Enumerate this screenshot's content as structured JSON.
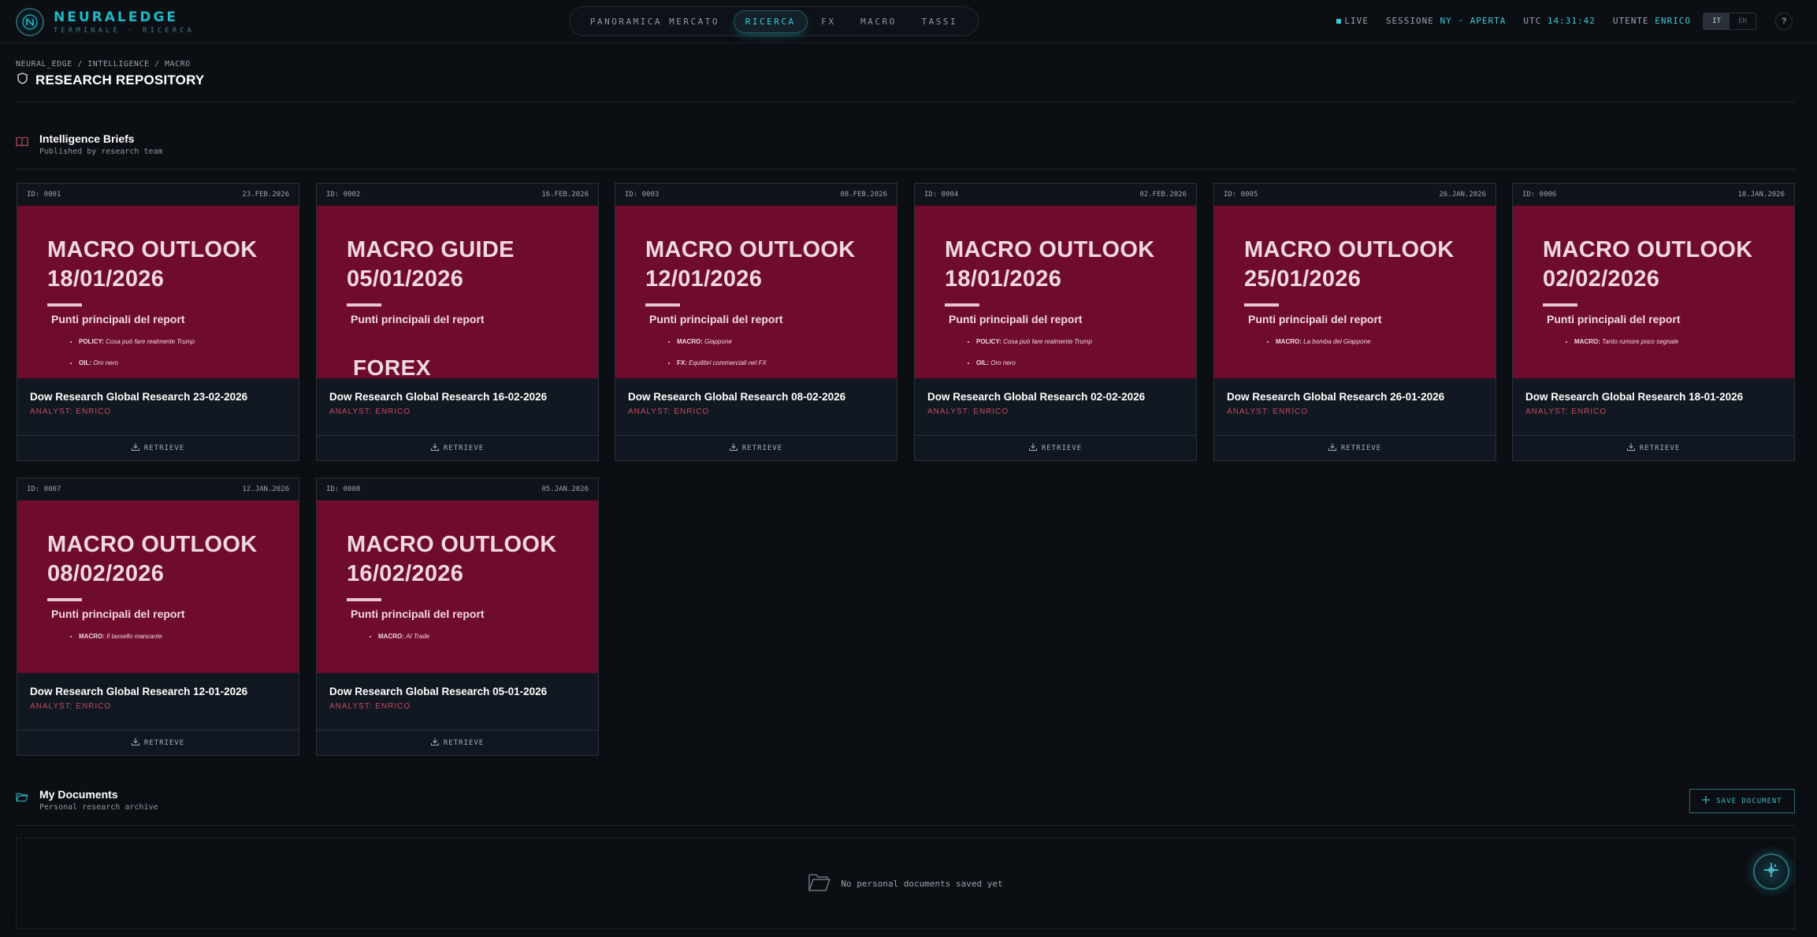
{
  "app": {
    "name": "NEURALEDGE",
    "subtitle": "TERMINALE · RICERCA"
  },
  "nav": {
    "tabs": [
      {
        "label": "PANORAMICA MERCATO",
        "active": false
      },
      {
        "label": "RICERCA",
        "active": true
      },
      {
        "label": "FX",
        "active": false
      },
      {
        "label": "MACRO",
        "active": false
      },
      {
        "label": "TASSI",
        "active": false
      }
    ]
  },
  "status": {
    "live": "LIVE",
    "session_label": "SESSIONE",
    "session_value": "NY · APERTA",
    "utc_label": "UTC",
    "utc_value": "14:31:42",
    "user_label": "UTENTE",
    "user_value": "ENRICO"
  },
  "lang": {
    "it": "IT",
    "en": "EN",
    "active": "IT"
  },
  "help": "?",
  "breadcrumb": "NEURAL_EDGE / INTELLIGENCE / MACRO",
  "page_title": "RESEARCH REPOSITORY",
  "briefs": {
    "title": "Intelligence Briefs",
    "subtitle": "Published by research team",
    "retrieve_label": "RETRIEVE",
    "cover_subtitle": "Punti principali del report",
    "cards": [
      {
        "id": "ID: 0001",
        "date": "23.FEB.2026",
        "cover_title": "MACRO OUTLOOK\n18/01/2026",
        "bullets": [
          {
            "k": "POLICY:",
            "v": "Cosa può fare realmente Trump"
          },
          {
            "k": "OIL:",
            "v": "Oro nero"
          }
        ],
        "name": "Dow Research Global Research 23-02-2026",
        "analyst": "ANALYST: ENRICO"
      },
      {
        "id": "ID: 0002",
        "date": "16.FEB.2026",
        "cover_title": "MACRO GUIDE\n05/01/2026",
        "cover_big": "FOREX",
        "bullets": [],
        "name": "Dow Research Global Research 16-02-2026",
        "analyst": "ANALYST: ENRICO"
      },
      {
        "id": "ID: 0003",
        "date": "08.FEB.2026",
        "cover_title": "MACRO OUTLOOK\n12/01/2026",
        "bullets": [
          {
            "k": "MACRO:",
            "v": "Giappone"
          },
          {
            "k": "FX:",
            "v": "Equilibri commerciali nel FX"
          }
        ],
        "name": "Dow Research Global Research 08-02-2026",
        "analyst": "ANALYST: ENRICO"
      },
      {
        "id": "ID: 0004",
        "date": "02.FEB.2026",
        "cover_title": "MACRO OUTLOOK\n18/01/2026",
        "bullets": [
          {
            "k": "POLICY:",
            "v": "Cosa può fare realmente Trump"
          },
          {
            "k": "OIL:",
            "v": "Oro nero"
          }
        ],
        "name": "Dow Research Global Research 02-02-2026",
        "analyst": "ANALYST: ENRICO"
      },
      {
        "id": "ID: 0005",
        "date": "26.JAN.2026",
        "cover_title": "MACRO OUTLOOK\n25/01/2026",
        "bullets": [
          {
            "k": "MACRO:",
            "v": "La bomba del Giappone"
          }
        ],
        "name": "Dow Research Global Research 26-01-2026",
        "analyst": "ANALYST: ENRICO"
      },
      {
        "id": "ID: 0006",
        "date": "18.JAN.2026",
        "cover_title": "MACRO OUTLOOK\n02/02/2026",
        "bullets": [
          {
            "k": "MACRO:",
            "v": "Tanto rumore poco segnale"
          }
        ],
        "name": "Dow Research Global Research 18-01-2026",
        "analyst": "ANALYST: ENRICO"
      },
      {
        "id": "ID: 0007",
        "date": "12.JAN.2026",
        "cover_title": "MACRO OUTLOOK\n08/02/2026",
        "bullets": [
          {
            "k": "MACRO:",
            "v": "Il tassello mancante"
          }
        ],
        "name": "Dow Research Global Research 12-01-2026",
        "analyst": "ANALYST: ENRICO"
      },
      {
        "id": "ID: 0008",
        "date": "05.JAN.2026",
        "cover_title": "MACRO OUTLOOK\n16/02/2026",
        "bullets": [
          {
            "k": "MACRO:",
            "v": "AI Trade"
          }
        ],
        "name": "Dow Research Global Research 05-01-2026",
        "analyst": "ANALYST: ENRICO"
      }
    ]
  },
  "documents": {
    "title": "My Documents",
    "subtitle": "Personal research archive",
    "save_label": "SAVE DOCUMENT",
    "empty_text": "No personal documents saved yet"
  },
  "colors": {
    "accent": "#3cc9d6",
    "cover": "#6f0b2d",
    "analyst": "#c04a63",
    "background": "#0b0e13"
  },
  "icons": [
    "logo-icon",
    "shield-icon",
    "book-icon",
    "download-icon",
    "folder-icon",
    "plus-icon",
    "assistant-icon"
  ]
}
